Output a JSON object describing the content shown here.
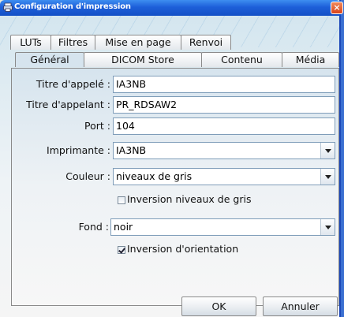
{
  "window": {
    "title": "Configuration d'impression",
    "close_label": "×"
  },
  "tabs_row1": [
    {
      "label": "LUTs"
    },
    {
      "label": "Filtres"
    },
    {
      "label": "Mise en page"
    },
    {
      "label": "Renvoi"
    }
  ],
  "tabs_row2": [
    {
      "label": "Général",
      "active": true
    },
    {
      "label": "DICOM Store"
    },
    {
      "label": "Contenu"
    },
    {
      "label": "Média"
    }
  ],
  "form": {
    "called_title": {
      "label": "Titre d'appelé :",
      "value": "IA3NB"
    },
    "calling_title": {
      "label": "Titre d'appelant :",
      "value": "PR_RDSAW2"
    },
    "port": {
      "label": "Port :",
      "value": "104"
    },
    "printer": {
      "label": "Imprimante :",
      "selected": "IA3NB"
    },
    "color": {
      "label": "Couleur :",
      "selected": "niveaux de gris"
    },
    "invert_gray": {
      "label": "Inversion niveaux de gris",
      "checked": false
    },
    "background": {
      "label": "Fond :",
      "selected": "noir"
    },
    "invert_orientation": {
      "label": "Inversion d'orientation",
      "checked": true
    }
  },
  "buttons": {
    "ok": "OK",
    "cancel": "Annuler"
  }
}
